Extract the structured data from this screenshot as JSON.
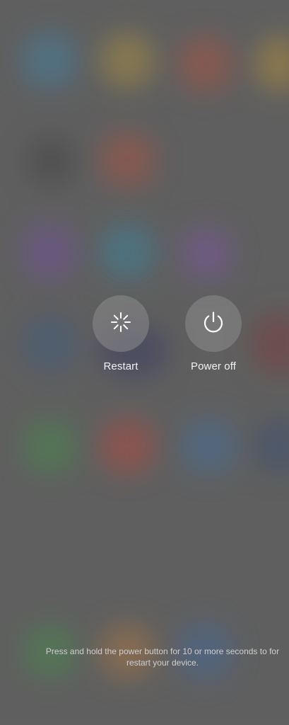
{
  "overlay": {
    "restart_label": "Restart",
    "poweroff_label": "Power off",
    "hint_line1": "Press and hold the power button for 10 or more seconds to for",
    "hint_line2": "restart your device."
  },
  "colors": {
    "background": "#606060",
    "button_fill": "rgba(140,140,140,0.55)",
    "label_text": "#f2f2f2",
    "hint_text": "#cfcfcf"
  },
  "icons": {
    "restart": "restart-spinner-icon",
    "poweroff": "power-icon"
  }
}
